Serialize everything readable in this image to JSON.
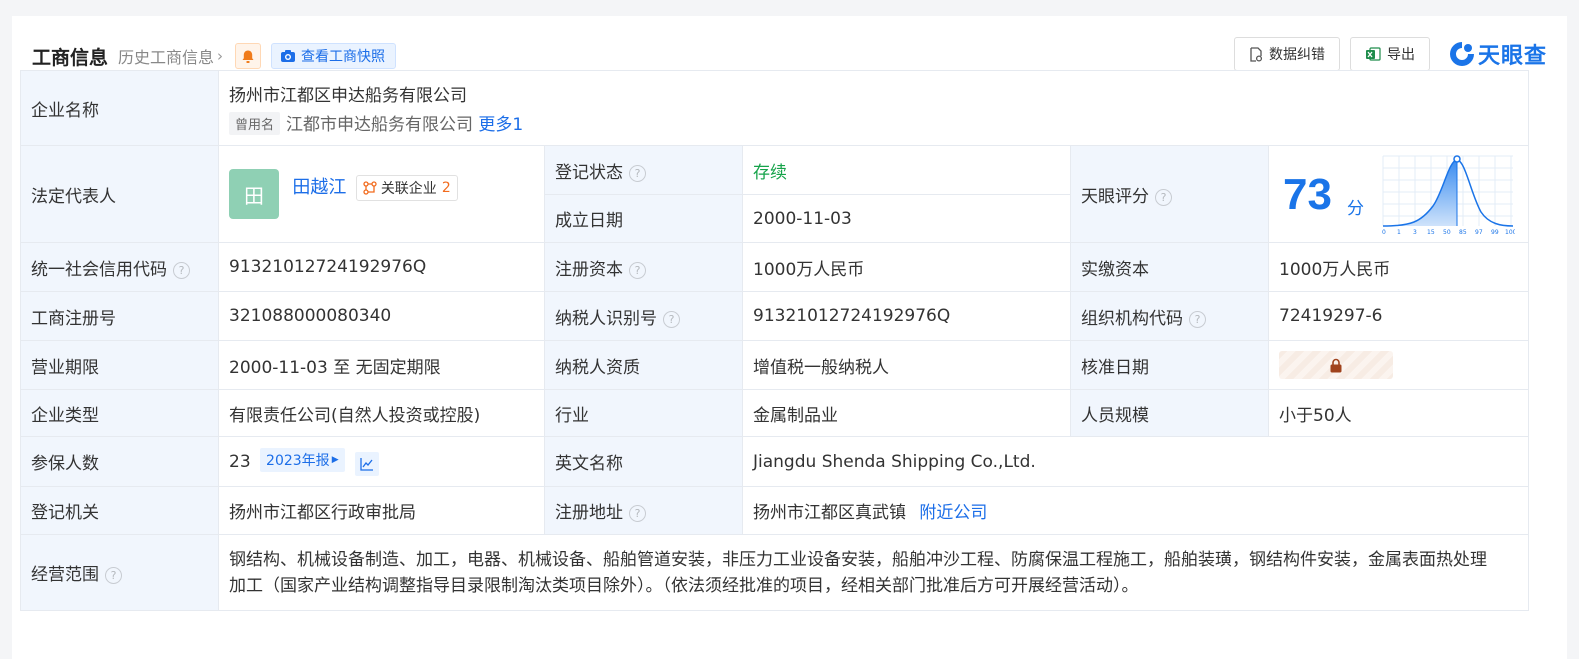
{
  "header": {
    "title": "工商信息",
    "history_link": "历史工商信息",
    "snapshot_label": "查看工商快照",
    "correct_label": "数据纠错",
    "export_label": "导出",
    "logo": "天眼查"
  },
  "company": {
    "name_label": "企业名称",
    "name": "扬州市江都区申达船务有限公司",
    "former_tag": "曾用名",
    "former_name": "江都市申达船务有限公司",
    "more": "更多1"
  },
  "legal": {
    "label": "法定代表人",
    "avatar_char": "田",
    "name": "田越江",
    "related_label": "关联企业",
    "related_count": "2"
  },
  "status": {
    "label": "登记状态",
    "value": "存续"
  },
  "established": {
    "label": "成立日期",
    "value": "2000-11-03"
  },
  "tianyan_score": {
    "label": "天眼评分",
    "value": "73",
    "unit": "分",
    "axis_ticks": [
      "0",
      "1",
      "3",
      "15",
      "50",
      "85",
      "97",
      "99",
      "100"
    ]
  },
  "credit_code": {
    "label": "统一社会信用代码",
    "value": "91321012724192976Q"
  },
  "reg_capital": {
    "label": "注册资本",
    "value": "1000万人民币"
  },
  "paid_capital": {
    "label": "实缴资本",
    "value": "1000万人民币"
  },
  "reg_number": {
    "label": "工商注册号",
    "value": "321088000080340"
  },
  "taxpayer_id": {
    "label": "纳税人识别号",
    "value": "91321012724192976Q"
  },
  "org_code": {
    "label": "组织机构代码",
    "value": "72419297-6"
  },
  "term": {
    "label": "营业期限",
    "value": "2000-11-03 至 无固定期限"
  },
  "tax_qual": {
    "label": "纳税人资质",
    "value": "增值税一般纳税人"
  },
  "approve_date": {
    "label": "核准日期"
  },
  "type": {
    "label": "企业类型",
    "value": "有限责任公司(自然人投资或控股)"
  },
  "industry": {
    "label": "行业",
    "value": "金属制品业"
  },
  "staff": {
    "label": "人员规模",
    "value": "小于50人"
  },
  "insured": {
    "label": "参保人数",
    "value": "23",
    "report": "2023年报"
  },
  "english": {
    "label": "英文名称",
    "value": "Jiangdu Shenda Shipping Co.,Ltd."
  },
  "authority": {
    "label": "登记机关",
    "value": "扬州市江都区行政审批局"
  },
  "address": {
    "label": "注册地址",
    "value": "扬州市江都区真武镇",
    "nearby": "附近公司"
  },
  "scope": {
    "label": "经营范围",
    "line1": "钢结构、机械设备制造、加工，电器、机械设备、船舶管道安装，非压力工业设备安装，船舶冲沙工程、防腐保温工程施工，船舶装璜，钢结构件安装，金属表面热处理",
    "line2": "加工（国家产业结构调整指导目录限制淘汰类项目除外）。（依法须经批准的项目，经相关部门批准后方可开展经营活动）。"
  },
  "colors": {
    "accent": "#1c6ee8",
    "label_bg": "#f1f6fd",
    "status_green": "#16a34a",
    "count_orange": "#f26b1d"
  }
}
